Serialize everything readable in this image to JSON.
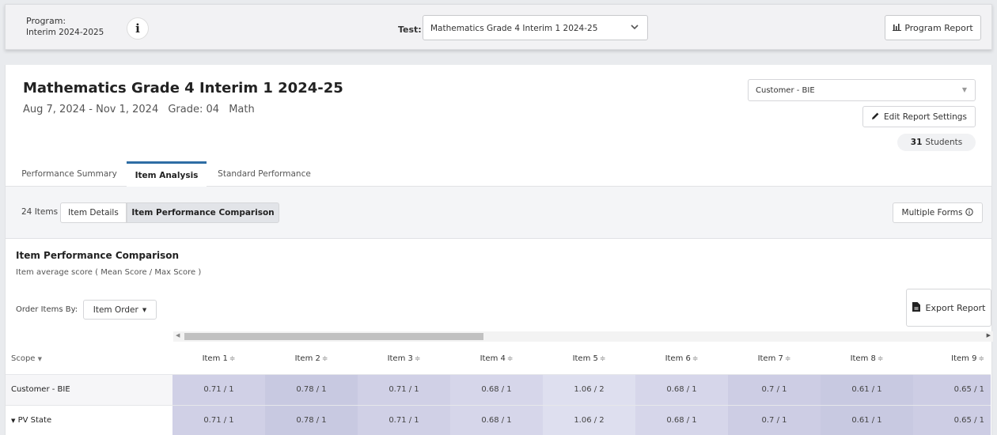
{
  "topbar": {
    "program_label": "Program:",
    "program_value": "Interim 2024-2025",
    "info_icon": "i",
    "test_label": "Test:",
    "test_value": "Mathematics Grade 4 Interim 1 2024-25",
    "program_report_label": "Program Report"
  },
  "header": {
    "title": "Mathematics Grade 4 Interim 1 2024-25",
    "date_range": "Aug 7, 2024 - Nov 1, 2024",
    "grade": "Grade: 04",
    "subject": "Math",
    "customer_value": "Customer - BIE",
    "edit_settings_label": "Edit Report Settings",
    "students_count": "31",
    "students_label": "Students"
  },
  "tabs": [
    {
      "label": "Performance Summary"
    },
    {
      "label": "Item Analysis"
    },
    {
      "label": "Standard Performance"
    }
  ],
  "subbar": {
    "items_count": "24 Items",
    "item_details_label": "Item Details",
    "item_perf_label": "Item Performance Comparison",
    "multiple_forms_label": "Multiple Forms"
  },
  "section": {
    "title": "Item Performance Comparison",
    "subtitle": "Item average score ( Mean Score / Max Score )",
    "order_label": "Order Items By:",
    "order_value": "Item Order",
    "export_label": "Export Report"
  },
  "table": {
    "scope_header": "Scope",
    "items": [
      "Item 1",
      "Item 2",
      "Item 3",
      "Item 4",
      "Item 5",
      "Item 6",
      "Item 7",
      "Item 8",
      "Item 9"
    ],
    "rows": [
      {
        "scope": "Customer - BIE",
        "values": [
          "0.71 / 1",
          "0.78 / 1",
          "0.71 / 1",
          "0.68 / 1",
          "1.06 / 2",
          "0.68 / 1",
          "0.7 / 1",
          "0.61 / 1",
          "0.65 / 1"
        ]
      },
      {
        "scope": "PV State",
        "values": [
          "0.71 / 1",
          "0.78 / 1",
          "0.71 / 1",
          "0.68 / 1",
          "1.06 / 2",
          "0.68 / 1",
          "0.7 / 1",
          "0.61 / 1",
          "0.65 / 1"
        ]
      }
    ]
  },
  "colors": {
    "accent_tab": "#2e6da4",
    "cell_shade": "#d0d0e6"
  }
}
